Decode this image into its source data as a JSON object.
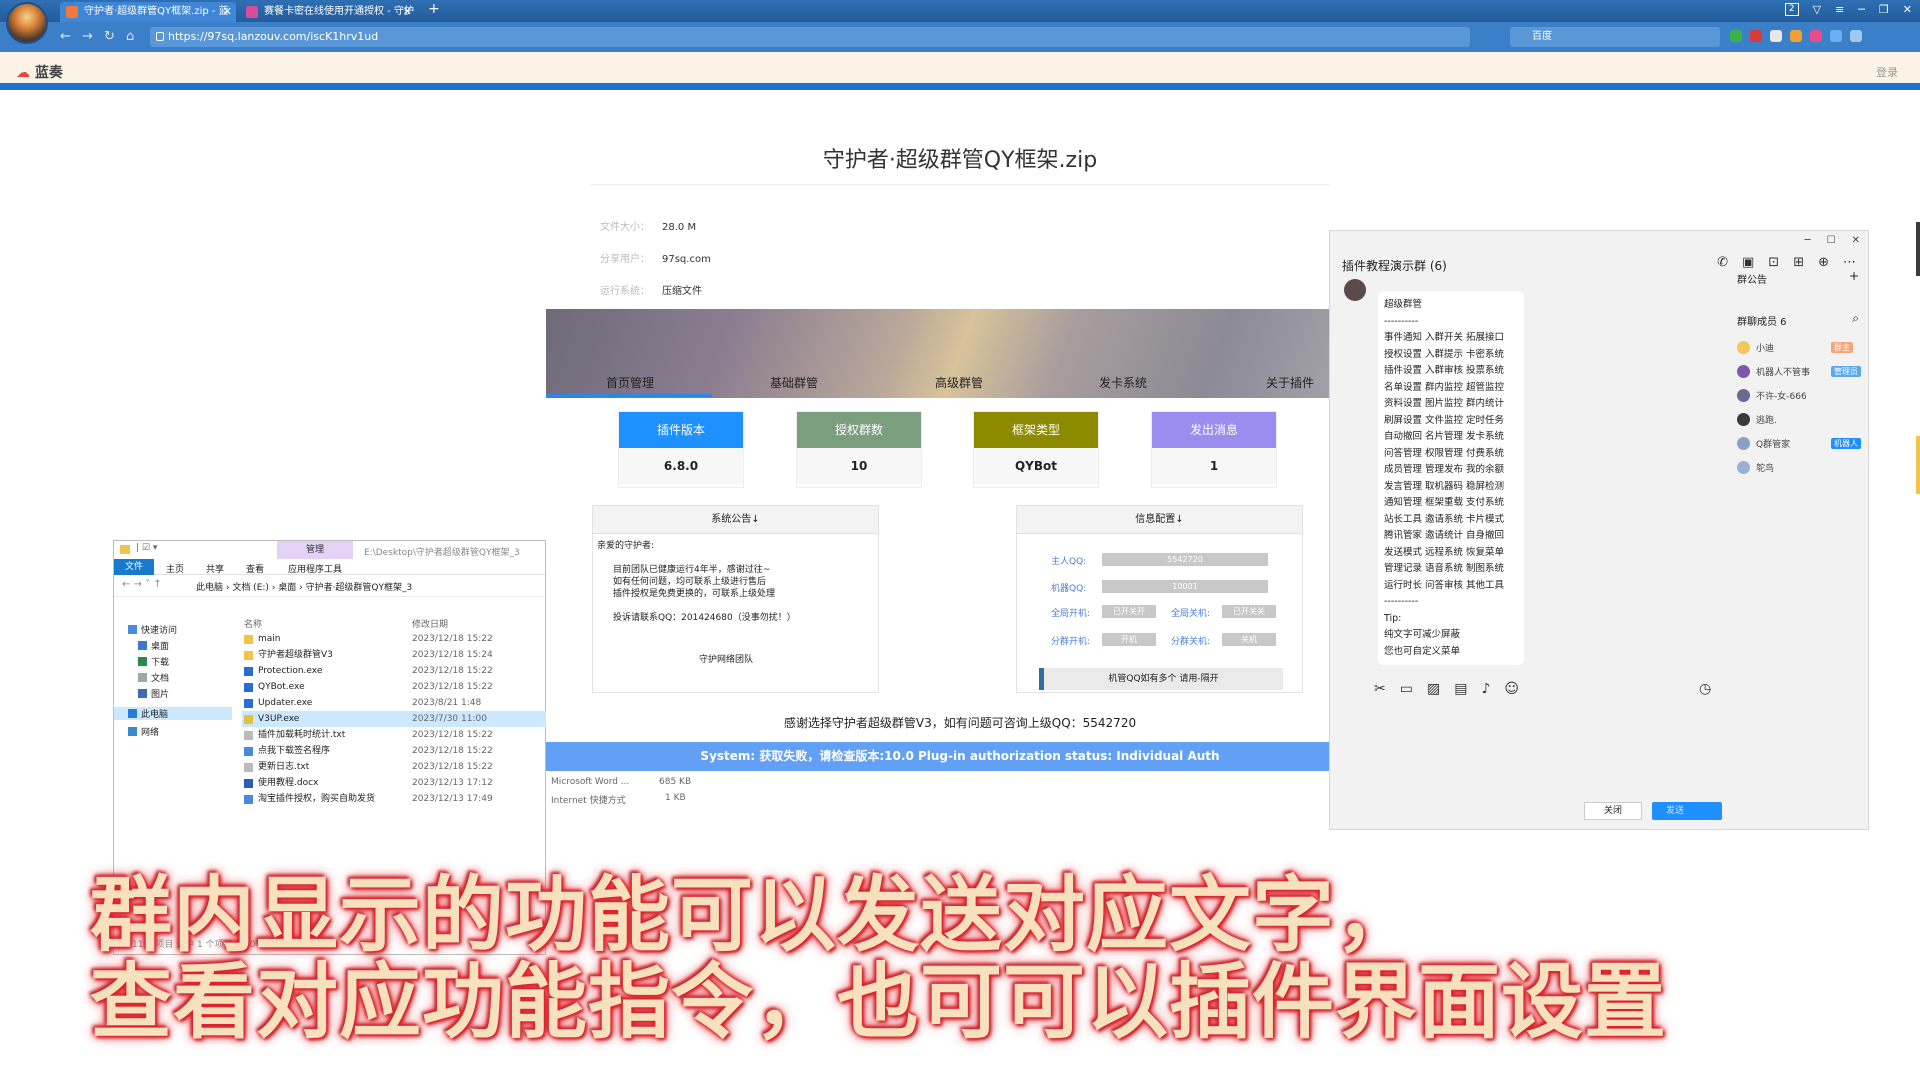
{
  "browser": {
    "tabs": [
      {
        "title": "守护者·超级群管QY框架.zip - 蓝",
        "active": true
      },
      {
        "title": "赛餐卡密在线使用开通授权 - 守护",
        "active": false
      }
    ],
    "new_tab": "+",
    "url": "https://97sq.lanzouv.com/iscK1hrv1ud",
    "search_engine": "百度",
    "tab_count": "2"
  },
  "site": {
    "logo": "蓝奏",
    "login": "登录"
  },
  "file": {
    "title": "守护者·超级群管QY框架.zip",
    "meta": [
      {
        "key": "文件大小：",
        "value": "28.0 M"
      },
      {
        "key": "分享用户：",
        "value": "97sq.com"
      },
      {
        "key": "运行系统：",
        "value": "压缩文件"
      }
    ]
  },
  "plugin": {
    "close": "✕",
    "tabs": [
      "首页管理",
      "基础群管",
      "高级群管",
      "发卡系统",
      "关于插件"
    ],
    "stats": [
      {
        "label": "插件版本",
        "value": "6.8.0",
        "color": "#1e90ff"
      },
      {
        "label": "授权群数",
        "value": "10",
        "color": "#7a9e7e"
      },
      {
        "label": "框架类型",
        "value": "QYBot",
        "color": "#8e8a00"
      },
      {
        "label": "发出消息",
        "value": "1",
        "color": "#9b8cf0"
      }
    ],
    "notice": {
      "title": "系统公告↓",
      "greeting": "亲爱的守护者:",
      "lines": [
        "目前团队已健康运行4年半，感谢过往~",
        "如有任何问题，均可联系上级进行售后",
        "插件授权是免费更换的，可联系上级处理"
      ],
      "contact": "投诉请联系QQ：201424680（没事勿扰！）",
      "sign": "守护网络团队"
    },
    "config": {
      "title": "信息配置↓",
      "master_qq_label": "主人QQ:",
      "master_qq": "5542720",
      "bot_qq_label": "机器QQ:",
      "bot_qq": "10001",
      "global_on_label": "全局开机:",
      "global_on_btn": "已开关开",
      "global_off_label": "全局关机:",
      "global_off_btn": "已开关关",
      "group_on_label": "分群开机:",
      "group_on_btn": "开机",
      "group_off_label": "分群关机:",
      "group_off_btn": "关机",
      "bar": "机管QQ如有多个 请用-隔开"
    },
    "thanks": "感谢选择守护者超级群管V3，如有问题可咨询上级QQ：5542720",
    "system": "System:  获取失败，请检查版本:10.0   Plug-in authorization status:  Individual Auth"
  },
  "explorer": {
    "manage": "管理",
    "path_title": "E:\\Desktop\\守护者超级群管QY框架_3",
    "ribbon": [
      "文件",
      "主页",
      "共享",
      "查看",
      "应用程序工具"
    ],
    "crumbs": "此电脑  ›  文档 (E:)  ›  桌面  ›  守护者·超级群管QY框架_3",
    "sidebar": [
      "快速访问",
      "桌面",
      "下载",
      "文档",
      "图片",
      "此电脑",
      "网络"
    ],
    "col_name": "名称",
    "col_date": "修改日期",
    "files": [
      {
        "name": "main",
        "date": "2023/12/18 15:22",
        "type": "folder"
      },
      {
        "name": "守护者超级群管V3",
        "date": "2023/12/18 15:24",
        "type": "folder"
      },
      {
        "name": "Protection.exe",
        "date": "2023/12/18 15:22",
        "type": "exe"
      },
      {
        "name": "QYBot.exe",
        "date": "2023/12/18 15:22",
        "type": "exe"
      },
      {
        "name": "Updater.exe",
        "date": "2023/8/21 1:48",
        "type": "exe"
      },
      {
        "name": "V3UP.exe",
        "date": "2023/7/30 11:00",
        "type": "exe-yellow"
      },
      {
        "name": "插件加载耗时统计.txt",
        "date": "2023/12/18 15:22",
        "type": "txt"
      },
      {
        "name": "点我下载签名程序",
        "date": "2023/12/18 15:22",
        "type": "link"
      },
      {
        "name": "更新日志.txt",
        "date": "2023/12/18 15:22",
        "type": "txt"
      },
      {
        "name": "使用教程.docx",
        "date": "2023/12/13 17:12",
        "type": "doc"
      },
      {
        "name": "淘宝插件授权，购买自助发货",
        "date": "2023/12/13 17:49",
        "type": "link"
      }
    ],
    "extra": [
      {
        "type": "Microsoft Word ...",
        "size": "685 KB"
      },
      {
        "type": "Internet 快捷方式",
        "size": "1 KB"
      }
    ],
    "status": "11 个项目    选中 1 个项目  8.20 KB"
  },
  "qq": {
    "title": "插件教程演示群 (6)",
    "bubble_title": "超级群管",
    "bubble_sep": "----------",
    "bubble_lines": [
      "事件通知 入群开关 拓展接口",
      "授权设置 入群提示 卡密系统",
      "插件设置 入群审核 投票系统",
      "名单设置 群内监控 超管监控",
      "资料设置 图片监控 群内统计",
      "刷屏设置 文件监控 定时任务",
      "自动撤回 名片管理 发卡系统",
      "问答管理 权限管理 付费系统",
      "成员管理 管理发布 我的余额",
      "发言管理 取机器码 稳屏检测",
      "通知管理 框架重载 支付系统",
      "站长工具 邀请系统 卡片模式",
      "腾讯管家 邀请统计 自身撤回",
      "发送模式 远程系统 恢复菜单",
      "管理记录 语音系统 制图系统",
      "运行时长 问答审核 其他工具"
    ],
    "bubble_sep2": "----------",
    "bubble_tip": "Tip:",
    "bubble_tip1": "纯文字可减少屏蔽",
    "bubble_tip2": "您也可自定义菜单",
    "announcement": "群公告",
    "members_title": "群聊成员 6",
    "members": [
      {
        "name": "小迪",
        "tag": "群主",
        "tag_color": "#f5a57a",
        "avatar": "#f3c75a"
      },
      {
        "name": "机器人不管事",
        "tag": "管理员",
        "tag_color": "#5aa8f0",
        "avatar": "#7a5aa8"
      },
      {
        "name": "不许-女-666",
        "tag": "",
        "tag_color": "",
        "avatar": "#6a6a8a"
      },
      {
        "name": "逃跑.",
        "tag": "",
        "tag_color": "",
        "avatar": "#3a3a3a"
      },
      {
        "name": "Q群管家",
        "tag": "机器人",
        "tag_color": "#1e8fff",
        "avatar": "#8aa0c8"
      },
      {
        "name": "鸵鸟",
        "tag": "",
        "tag_color": "",
        "avatar": "#9ab0d0"
      }
    ],
    "close_btn": "关闭",
    "send_btn": "发送"
  },
  "subtitle": {
    "line1": "群内显示的功能可以发送对应文字，",
    "line2": "查看对应功能指令，也可可以插件界面设置"
  }
}
